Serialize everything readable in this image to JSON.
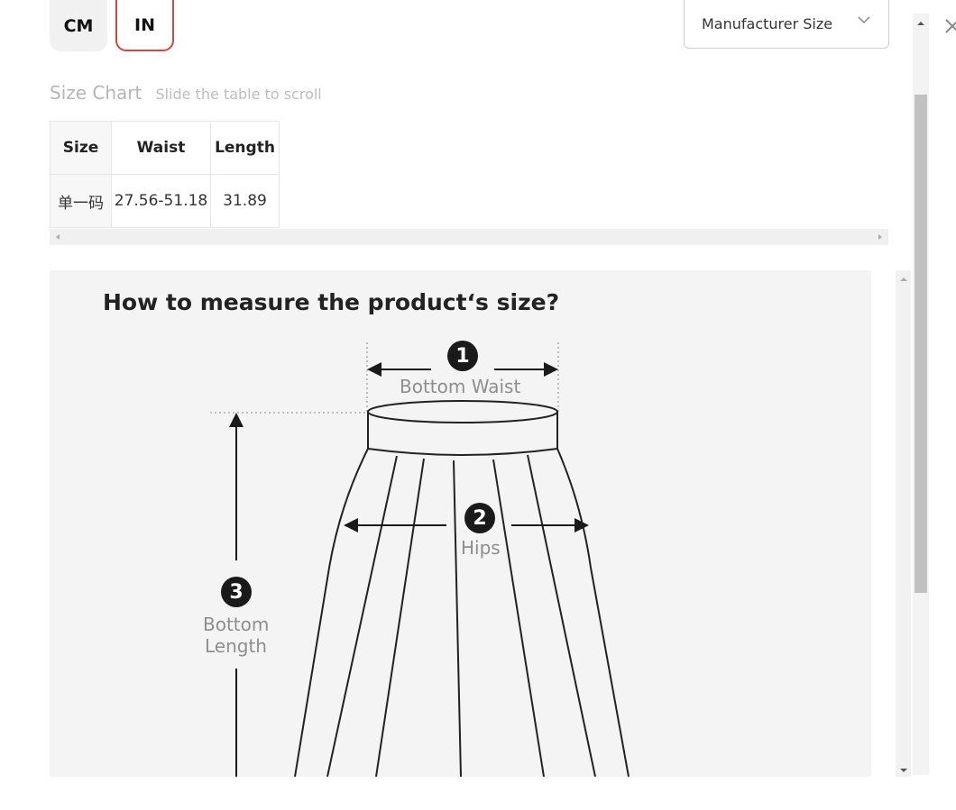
{
  "units": {
    "cm_label": "CM",
    "in_label": "IN",
    "selected": "IN"
  },
  "size_select": {
    "value": "Manufacturer Size"
  },
  "size_chart": {
    "title": "Size Chart",
    "hint": "Slide the table to scroll",
    "columns": [
      "Size",
      "Waist",
      "Length"
    ],
    "rows": [
      [
        "单一码",
        "27.56-51.18",
        "31.89"
      ]
    ]
  },
  "measure_image": {
    "title": "How to measure the product‘s size?",
    "points": [
      {
        "number": "1",
        "label": "Bottom Waist"
      },
      {
        "number": "2",
        "label": "Hips"
      },
      {
        "number": "3",
        "label_line1": "Bottom",
        "label_line2": "Length"
      }
    ]
  },
  "colors": {
    "accent": "#d9443f",
    "panel_bg": "#f4f4f4"
  },
  "icons": {
    "close": "close-icon",
    "dropdown": "chevron-down-icon"
  }
}
